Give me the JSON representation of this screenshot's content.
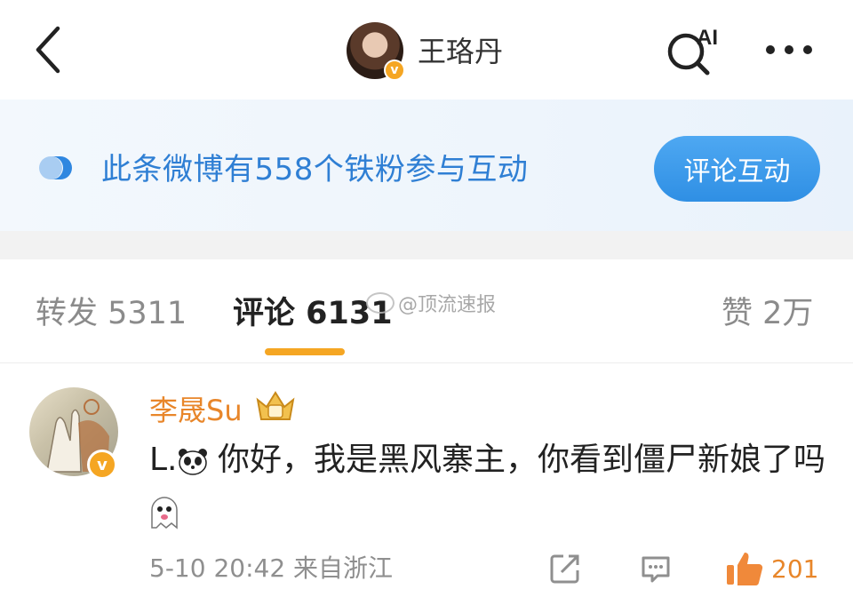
{
  "header": {
    "user_name": "王珞丹",
    "verified_mark": "v",
    "ai_label": "AI"
  },
  "banner": {
    "text": "此条微博有558个铁粉参与互动",
    "button_label": "评论互动"
  },
  "tabs": {
    "repost": "转发 5311",
    "comment": "评论 6131",
    "like": "赞 2万"
  },
  "watermark": "@顶流速报",
  "comment": {
    "author": "李晟Su",
    "verified_mark": "v",
    "text_prefix": "L.",
    "text_main": " 你好，我是黑风寨主，你看到僵尸新娘了吗",
    "time_location": "5-10 20:42 来自浙江",
    "like_count": "201"
  },
  "colors": {
    "accent_orange": "#f5a623",
    "name_orange": "#e8862a",
    "banner_blue": "#2f7fd4",
    "button_blue": "#3a98ea"
  },
  "icons": [
    "back-arrow-icon",
    "ai-search-icon",
    "more-icon",
    "fans-icon",
    "panda-emoji-icon",
    "ghost-emoji-icon",
    "share-icon",
    "reply-icon",
    "thumb-up-icon",
    "vip-crown-badge-icon"
  ]
}
